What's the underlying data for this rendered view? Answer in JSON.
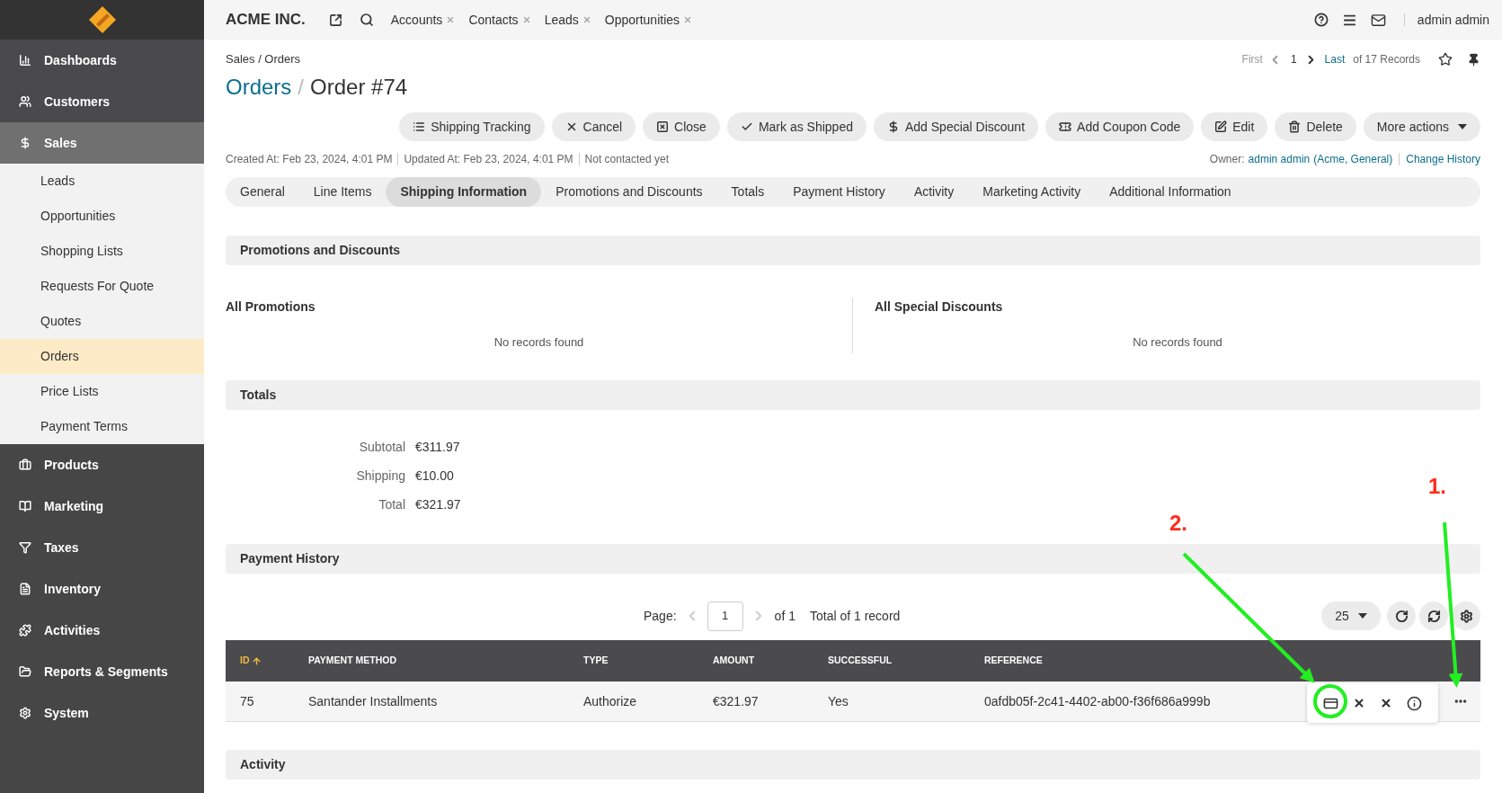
{
  "brand": "ACME INC.",
  "nav_tabs": [
    {
      "label": "Accounts"
    },
    {
      "label": "Contacts"
    },
    {
      "label": "Leads"
    },
    {
      "label": "Opportunities"
    }
  ],
  "user": "admin admin",
  "sidebar": {
    "items": [
      {
        "label": "Dashboards",
        "selected": false
      },
      {
        "label": "Customers",
        "selected": false
      },
      {
        "label": "Sales",
        "selected": true,
        "expanded": true,
        "children": [
          {
            "label": "Leads",
            "selected": false
          },
          {
            "label": "Opportunities",
            "selected": false
          },
          {
            "label": "Shopping Lists",
            "selected": false
          },
          {
            "label": "Requests For Quote",
            "selected": false
          },
          {
            "label": "Quotes",
            "selected": false
          },
          {
            "label": "Orders",
            "selected": true
          },
          {
            "label": "Price Lists",
            "selected": false
          },
          {
            "label": "Payment Terms",
            "selected": false
          }
        ]
      },
      {
        "label": "Products",
        "selected": false
      },
      {
        "label": "Marketing",
        "selected": false
      },
      {
        "label": "Taxes",
        "selected": false
      },
      {
        "label": "Inventory",
        "selected": false
      },
      {
        "label": "Activities",
        "selected": false
      },
      {
        "label": "Reports & Segments",
        "selected": false
      },
      {
        "label": "System",
        "selected": false
      }
    ]
  },
  "breadcrumb": "Sales / Orders",
  "record_pager": {
    "first": "First",
    "current": "1",
    "last": "Last",
    "count": "of 17 Records"
  },
  "title": {
    "parent": "Orders",
    "separator": "/",
    "current": "Order #74"
  },
  "actions": [
    {
      "label": "Shipping Tracking",
      "kind": "button"
    },
    {
      "label": "Cancel",
      "kind": "button"
    },
    {
      "label": "Close",
      "kind": "button"
    },
    {
      "label": "Mark as Shipped",
      "kind": "button"
    },
    {
      "label": "Add Special Discount",
      "kind": "button"
    },
    {
      "label": "Add Coupon Code",
      "kind": "button"
    },
    {
      "label": "Edit",
      "kind": "button"
    },
    {
      "label": "Delete",
      "kind": "button"
    },
    {
      "label": "More actions",
      "kind": "dropdown"
    }
  ],
  "meta": [
    "Created At: Feb 23, 2024, 4:01 PM",
    "Updated At: Feb 23, 2024, 4:01 PM",
    "Not contacted yet"
  ],
  "owner": {
    "label": "Owner:",
    "name": "admin admin",
    "units": "(Acme, General)",
    "history": "Change History"
  },
  "tabs": [
    {
      "label": "General",
      "selected": false
    },
    {
      "label": "Line Items",
      "selected": false
    },
    {
      "label": "Shipping Information",
      "selected": true
    },
    {
      "label": "Promotions and Discounts",
      "selected": false
    },
    {
      "label": "Totals",
      "selected": false
    },
    {
      "label": "Payment History",
      "selected": false
    },
    {
      "label": "Activity",
      "selected": false
    },
    {
      "label": "Marketing Activity",
      "selected": false
    },
    {
      "label": "Additional Information",
      "selected": false
    }
  ],
  "promotions": {
    "title": "Promotions and Discounts",
    "columns": [
      {
        "title": "All Promotions",
        "empty": "No records found"
      },
      {
        "title": "All Special Discounts",
        "empty": "No records found"
      }
    ]
  },
  "totals": {
    "title": "Totals",
    "rows": [
      {
        "label": "Subtotal",
        "value": "€311.97"
      },
      {
        "label": "Shipping",
        "value": "€10.00"
      },
      {
        "label": "Total",
        "value": "€321.97"
      }
    ]
  },
  "payment_history": {
    "title": "Payment History",
    "pager": {
      "label": "Page:",
      "page": "1",
      "of": "of 1",
      "total": "Total of 1 record",
      "page_size": "25"
    },
    "columns": [
      {
        "label": "ID",
        "sorted": true
      },
      {
        "label": "PAYMENT METHOD",
        "sorted": false
      },
      {
        "label": "TYPE",
        "sorted": false
      },
      {
        "label": "AMOUNT",
        "sorted": false
      },
      {
        "label": "SUCCESSFUL",
        "sorted": false
      },
      {
        "label": "REFERENCE",
        "sorted": false
      }
    ],
    "rows": [
      {
        "cells": [
          "75",
          "Santander Installments",
          "Authorize",
          "€321.97",
          "Yes",
          "0afdb05f-2c41-4402-ab00-f36f686a999b"
        ]
      }
    ]
  },
  "activity": {
    "title": "Activity"
  },
  "annotations": [
    {
      "label": "1."
    },
    {
      "label": "2."
    }
  ]
}
